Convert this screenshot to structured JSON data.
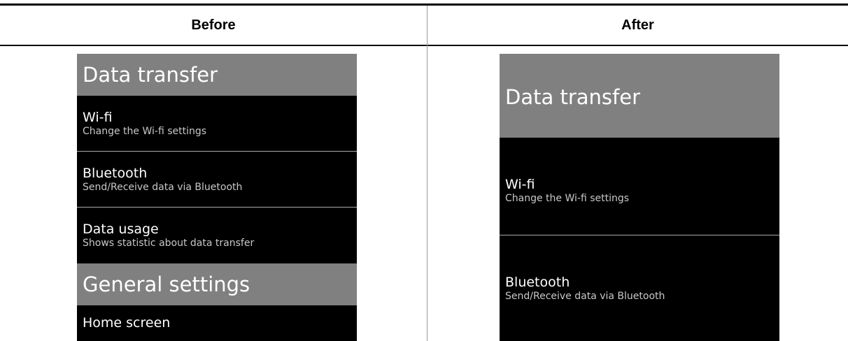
{
  "columns": {
    "before": "Before",
    "after": "After"
  },
  "before_panel": {
    "header_1": "Data transfer",
    "items": [
      {
        "title": "Wi-fi",
        "subtitle": "Change the Wi-fi settings"
      },
      {
        "title": "Bluetooth",
        "subtitle": "Send/Receive data via Bluetooth"
      },
      {
        "title": "Data usage",
        "subtitle": "Shows statistic about data transfer"
      }
    ],
    "header_2": "General settings",
    "tail_item": {
      "title": "Home screen"
    }
  },
  "after_panel": {
    "header_1": "Data transfer",
    "items": [
      {
        "title": "Wi-fi",
        "subtitle": "Change the Wi-fi settings"
      },
      {
        "title": "Bluetooth",
        "subtitle": "Send/Receive data via Bluetooth"
      }
    ]
  },
  "colors": {
    "header_bg": "#808080",
    "list_bg": "#000000",
    "separator": "#a8a8a8",
    "text": "#ffffff"
  }
}
